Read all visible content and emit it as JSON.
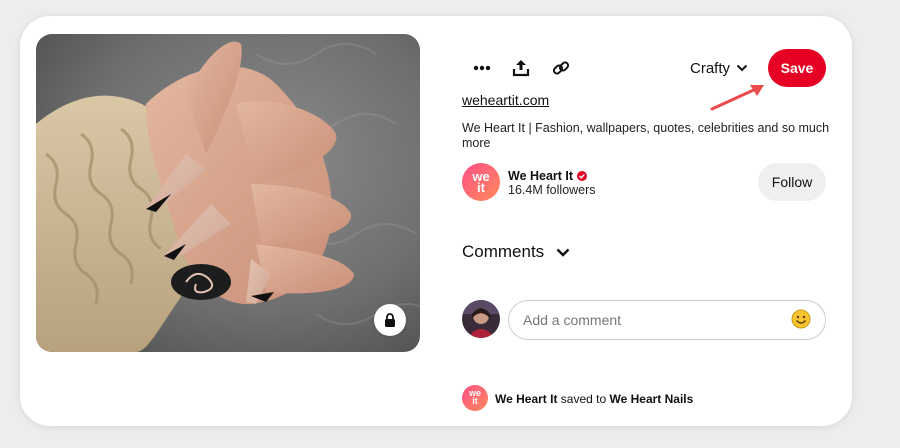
{
  "pin": {
    "image_alt": "Hand with black-tipped almond nails wearing knit sweater",
    "lock_icon": "lock-icon"
  },
  "toolbar": {
    "more_icon": "more-icon",
    "share_icon": "share-icon",
    "link_icon": "link-icon",
    "board_name": "Crafty",
    "save_label": "Save"
  },
  "source": {
    "domain": "weheartit.com",
    "description": "We Heart It | Fashion, wallpapers, quotes, celebrities and so much more"
  },
  "profile": {
    "avatar_text_top": "we",
    "avatar_text_bottom": "it",
    "name": "We Heart It",
    "followers": "16.4M followers",
    "follow_label": "Follow"
  },
  "comments": {
    "heading": "Comments",
    "placeholder": "Add a comment"
  },
  "activity": {
    "avatar_text_top": "we",
    "avatar_text_bottom": "it",
    "user": "We Heart It",
    "verb": " saved to ",
    "board": "We Heart Nails"
  },
  "colors": {
    "accent": "#e60023",
    "annotation_arrow": "#ec4b4b"
  }
}
